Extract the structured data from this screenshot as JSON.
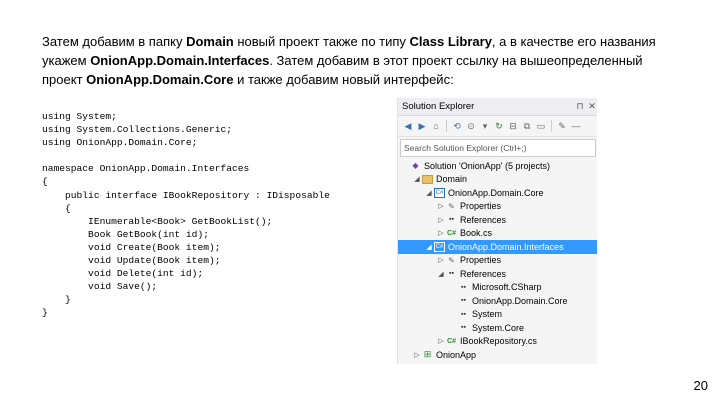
{
  "intro": {
    "s1": "Затем добавим в папку ",
    "b1": "Domain",
    "s2": " новый проект также по типу ",
    "b2": "Class Library",
    "s3": ", а в качестве его названия укажем ",
    "b3": "OnionApp.Domain.Interfaces",
    "s4": ". Затем добавим в этот проект ссылку на вышеопределенный проект ",
    "b4": "OnionApp.Domain.Core",
    "s5": " и также добавим новый интерфейс:"
  },
  "code": [
    "using System;",
    "using System.Collections.Generic;",
    "using OnionApp.Domain.Core;",
    "",
    "namespace OnionApp.Domain.Interfaces",
    "{",
    "    public interface IBookRepository : IDisposable",
    "    {",
    "        IEnumerable<Book> GetBookList();",
    "        Book GetBook(int id);",
    "        void Create(Book item);",
    "        void Update(Book item);",
    "        void Delete(int id);",
    "        void Save();",
    "    }",
    "}"
  ],
  "solution_explorer": {
    "title": "Solution Explorer",
    "pin_glyph": "⊓",
    "close_glyph": "✕",
    "search_placeholder": "Search Solution Explorer (Ctrl+;)",
    "tree": [
      {
        "label": "Solution 'OnionApp' (5 projects)",
        "indent": 0,
        "expander": "",
        "icon": "solution-icon",
        "selected": false
      },
      {
        "label": "Domain",
        "indent": 1,
        "expander": "◢",
        "icon": "folder-icon",
        "selected": false
      },
      {
        "label": "OnionApp.Domain.Core",
        "indent": 2,
        "expander": "◢",
        "icon": "csharp-project-icon",
        "selected": false
      },
      {
        "label": "Properties",
        "indent": 3,
        "expander": "▷",
        "icon": "wrench-icon",
        "selected": false
      },
      {
        "label": "References",
        "indent": 3,
        "expander": "▷",
        "icon": "references-icon",
        "selected": false
      },
      {
        "label": "Book.cs",
        "indent": 3,
        "expander": "▷",
        "icon": "csharp-file-icon",
        "selected": false
      },
      {
        "label": "OnionApp.Domain.Interfaces",
        "indent": 2,
        "expander": "◢",
        "icon": "csharp-project-icon",
        "selected": true
      },
      {
        "label": "Properties",
        "indent": 3,
        "expander": "▷",
        "icon": "wrench-icon",
        "selected": false
      },
      {
        "label": "References",
        "indent": 3,
        "expander": "◢",
        "icon": "references-icon",
        "selected": false
      },
      {
        "label": "Microsoft.CSharp",
        "indent": 4,
        "expander": "",
        "icon": "assembly-icon",
        "selected": false
      },
      {
        "label": "OnionApp.Domain.Core",
        "indent": 4,
        "expander": "",
        "icon": "assembly-icon",
        "selected": false
      },
      {
        "label": "System",
        "indent": 4,
        "expander": "",
        "icon": "assembly-icon",
        "selected": false
      },
      {
        "label": "System.Core",
        "indent": 4,
        "expander": "",
        "icon": "assembly-icon",
        "selected": false
      },
      {
        "label": "IBookRepository.cs",
        "indent": 3,
        "expander": "▷",
        "icon": "csharp-file-icon",
        "selected": false
      },
      {
        "label": "OnionApp",
        "indent": 1,
        "expander": "▷",
        "icon": "web-project-icon",
        "selected": false
      }
    ]
  },
  "page_number": "20",
  "colors": {
    "selection": "#3399ff",
    "highlight_line": "#d32f2f"
  }
}
